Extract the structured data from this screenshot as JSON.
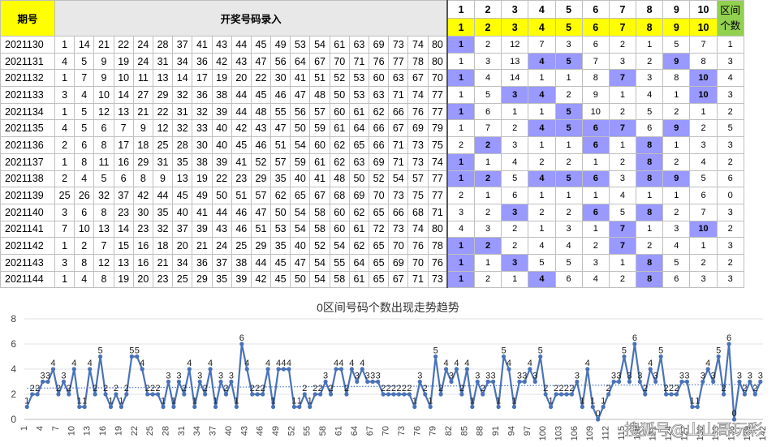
{
  "header": {
    "period_label": "期号",
    "draw_title": "开奖号码录入",
    "zone_numbers": [
      "1",
      "2",
      "3",
      "4",
      "5",
      "6",
      "7",
      "8",
      "9",
      "10"
    ],
    "count_label": "区间个数"
  },
  "rows": [
    {
      "period": "2021130",
      "nums": [
        1,
        14,
        21,
        22,
        24,
        28,
        37,
        41,
        43,
        44,
        45,
        49,
        53,
        54,
        61,
        63,
        69,
        73,
        74,
        80
      ],
      "zones": [
        1,
        2,
        12,
        7,
        3,
        6,
        2,
        1,
        5,
        7
      ],
      "hl": [
        0
      ],
      "count": 1
    },
    {
      "period": "2021131",
      "nums": [
        4,
        5,
        9,
        19,
        24,
        31,
        34,
        36,
        42,
        43,
        47,
        56,
        64,
        67,
        70,
        71,
        76,
        77,
        78,
        80
      ],
      "zones": [
        1,
        3,
        13,
        4,
        5,
        7,
        3,
        2,
        9,
        8
      ],
      "hl": [
        3,
        4,
        8
      ],
      "count": 3
    },
    {
      "period": "2021132",
      "nums": [
        1,
        7,
        9,
        10,
        11,
        13,
        14,
        17,
        19,
        20,
        22,
        30,
        41,
        51,
        52,
        53,
        60,
        63,
        67,
        70
      ],
      "zones": [
        1,
        4,
        14,
        1,
        1,
        8,
        7,
        3,
        8,
        10
      ],
      "hl": [
        0,
        6,
        9
      ],
      "count": 4
    },
    {
      "period": "2021133",
      "nums": [
        3,
        4,
        10,
        14,
        27,
        29,
        32,
        36,
        38,
        44,
        45,
        46,
        47,
        48,
        50,
        53,
        63,
        71,
        74,
        77
      ],
      "zones": [
        1,
        5,
        3,
        4,
        2,
        9,
        1,
        4,
        1,
        10
      ],
      "hl": [
        2,
        3,
        9
      ],
      "count": 3
    },
    {
      "period": "2021134",
      "nums": [
        1,
        5,
        12,
        13,
        21,
        22,
        31,
        32,
        39,
        44,
        48,
        55,
        56,
        57,
        60,
        61,
        62,
        66,
        76,
        77
      ],
      "zones": [
        1,
        6,
        1,
        1,
        5,
        10,
        2,
        5,
        2,
        1
      ],
      "hl": [
        0,
        4
      ],
      "count": 2
    },
    {
      "period": "2021135",
      "nums": [
        4,
        5,
        6,
        7,
        9,
        12,
        32,
        33,
        40,
        42,
        43,
        47,
        50,
        59,
        61,
        64,
        66,
        67,
        69,
        79
      ],
      "zones": [
        1,
        7,
        2,
        4,
        5,
        6,
        7,
        6,
        9,
        2
      ],
      "hl": [
        3,
        4,
        5,
        6,
        8
      ],
      "count": 5
    },
    {
      "period": "2021136",
      "nums": [
        2,
        6,
        8,
        17,
        18,
        25,
        28,
        30,
        40,
        45,
        46,
        51,
        54,
        60,
        62,
        65,
        66,
        71,
        73,
        75
      ],
      "zones": [
        2,
        2,
        3,
        1,
        1,
        6,
        1,
        8,
        1,
        3
      ],
      "hl": [
        1,
        5,
        7
      ],
      "count": 3
    },
    {
      "period": "2021137",
      "nums": [
        1,
        8,
        11,
        16,
        29,
        31,
        35,
        38,
        39,
        41,
        52,
        57,
        59,
        61,
        62,
        63,
        69,
        71,
        73,
        74
      ],
      "zones": [
        1,
        1,
        4,
        2,
        2,
        1,
        2,
        8,
        2,
        4
      ],
      "hl": [
        0,
        7
      ],
      "count": 2
    },
    {
      "period": "2021138",
      "nums": [
        2,
        4,
        5,
        6,
        8,
        9,
        13,
        19,
        22,
        23,
        29,
        35,
        40,
        41,
        48,
        50,
        52,
        54,
        57,
        77
      ],
      "zones": [
        1,
        2,
        5,
        4,
        5,
        6,
        3,
        8,
        9,
        5
      ],
      "hl": [
        0,
        1,
        3,
        4,
        5,
        7,
        8
      ],
      "count": 6
    },
    {
      "period": "2021139",
      "nums": [
        25,
        26,
        32,
        37,
        42,
        44,
        45,
        49,
        50,
        51,
        57,
        62,
        65,
        67,
        68,
        69,
        70,
        73,
        75,
        77
      ],
      "zones": [
        2,
        1,
        6,
        1,
        1,
        1,
        4,
        1,
        1,
        6
      ],
      "hl": [],
      "count": 0
    },
    {
      "period": "2021140",
      "nums": [
        3,
        6,
        8,
        23,
        30,
        35,
        40,
        41,
        44,
        46,
        47,
        50,
        54,
        58,
        60,
        62,
        65,
        66,
        68,
        71
      ],
      "zones": [
        3,
        2,
        3,
        2,
        2,
        6,
        5,
        8,
        2,
        7
      ],
      "hl": [
        2,
        5,
        7
      ],
      "count": 3
    },
    {
      "period": "2021141",
      "nums": [
        7,
        10,
        13,
        14,
        23,
        32,
        37,
        39,
        43,
        46,
        51,
        53,
        54,
        58,
        60,
        61,
        72,
        73,
        74,
        80
      ],
      "zones": [
        4,
        3,
        2,
        1,
        3,
        1,
        7,
        1,
        3,
        10
      ],
      "hl": [
        6,
        9
      ],
      "count": 2
    },
    {
      "period": "2021142",
      "nums": [
        1,
        2,
        7,
        15,
        16,
        18,
        20,
        21,
        24,
        25,
        29,
        35,
        40,
        52,
        54,
        62,
        65,
        70,
        76,
        78
      ],
      "zones": [
        1,
        2,
        2,
        4,
        4,
        2,
        7,
        2,
        4,
        1
      ],
      "hl": [
        0,
        1,
        6
      ],
      "count": 3
    },
    {
      "period": "2021143",
      "nums": [
        3,
        8,
        12,
        13,
        16,
        21,
        34,
        36,
        37,
        38,
        44,
        45,
        47,
        54,
        55,
        64,
        65,
        69,
        70,
        76
      ],
      "zones": [
        1,
        1,
        3,
        5,
        5,
        3,
        1,
        8,
        5,
        2
      ],
      "hl": [
        0,
        2,
        7
      ],
      "count": 2
    },
    {
      "period": "2021144",
      "nums": [
        1,
        4,
        8,
        19,
        20,
        23,
        25,
        29,
        35,
        39,
        42,
        45,
        50,
        54,
        58,
        61,
        65,
        67,
        71,
        73
      ],
      "zones": [
        1,
        2,
        1,
        4,
        6,
        4,
        2,
        8,
        6,
        3
      ],
      "hl": [
        0,
        3,
        7
      ],
      "count": 3
    }
  ],
  "chart_data": {
    "type": "line",
    "title": "0区间号码个数出现走势趋势",
    "xlabel": "",
    "ylabel": "",
    "ylim": [
      0,
      8
    ],
    "yticks": [
      "0",
      "2",
      "4",
      "6",
      "8"
    ],
    "xticks": [
      "1",
      "4",
      "7",
      "10",
      "13",
      "16",
      "19",
      "22",
      "25",
      "28",
      "31",
      "34",
      "37",
      "40",
      "43",
      "46",
      "49",
      "52",
      "55",
      "58",
      "61",
      "64",
      "67",
      "70",
      "73",
      "76",
      "79",
      "82",
      "85",
      "88",
      "91",
      "94",
      "97",
      "100",
      "103",
      "106",
      "109",
      "112",
      "115",
      "118",
      "121",
      "124",
      "127",
      "130",
      "133",
      "136",
      "139",
      "142"
    ],
    "grid": "horizontal",
    "trendline": "dotted linear",
    "values": [
      1,
      2,
      2,
      3,
      3,
      4,
      2,
      3,
      2,
      4,
      1,
      1,
      4,
      2,
      5,
      2,
      1,
      2,
      1,
      2,
      5,
      5,
      4,
      2,
      2,
      2,
      1,
      3,
      1,
      3,
      2,
      4,
      1,
      3,
      2,
      4,
      1,
      3,
      2,
      3,
      1,
      6,
      4,
      2,
      2,
      2,
      4,
      1,
      4,
      4,
      4,
      1,
      1,
      2,
      1,
      2,
      2,
      3,
      2,
      4,
      4,
      2,
      4,
      3,
      4,
      3,
      3,
      3,
      2,
      2,
      2,
      2,
      2,
      2,
      1,
      3,
      2,
      1,
      5,
      2,
      4,
      3,
      4,
      2,
      4,
      1,
      3,
      2,
      3,
      3,
      1,
      5,
      4,
      1,
      3,
      3,
      4,
      3,
      5,
      2,
      1,
      2,
      2,
      2,
      2,
      3,
      1,
      4,
      1,
      0,
      1,
      2,
      3,
      3,
      5,
      3,
      6,
      3,
      2,
      4,
      3,
      5,
      2,
      2,
      2,
      3,
      3,
      1,
      1,
      3,
      4,
      3,
      5,
      2,
      6,
      0,
      3,
      2,
      3,
      2,
      3
    ]
  },
  "watermark": "搜狐号@山山哥玩彩"
}
